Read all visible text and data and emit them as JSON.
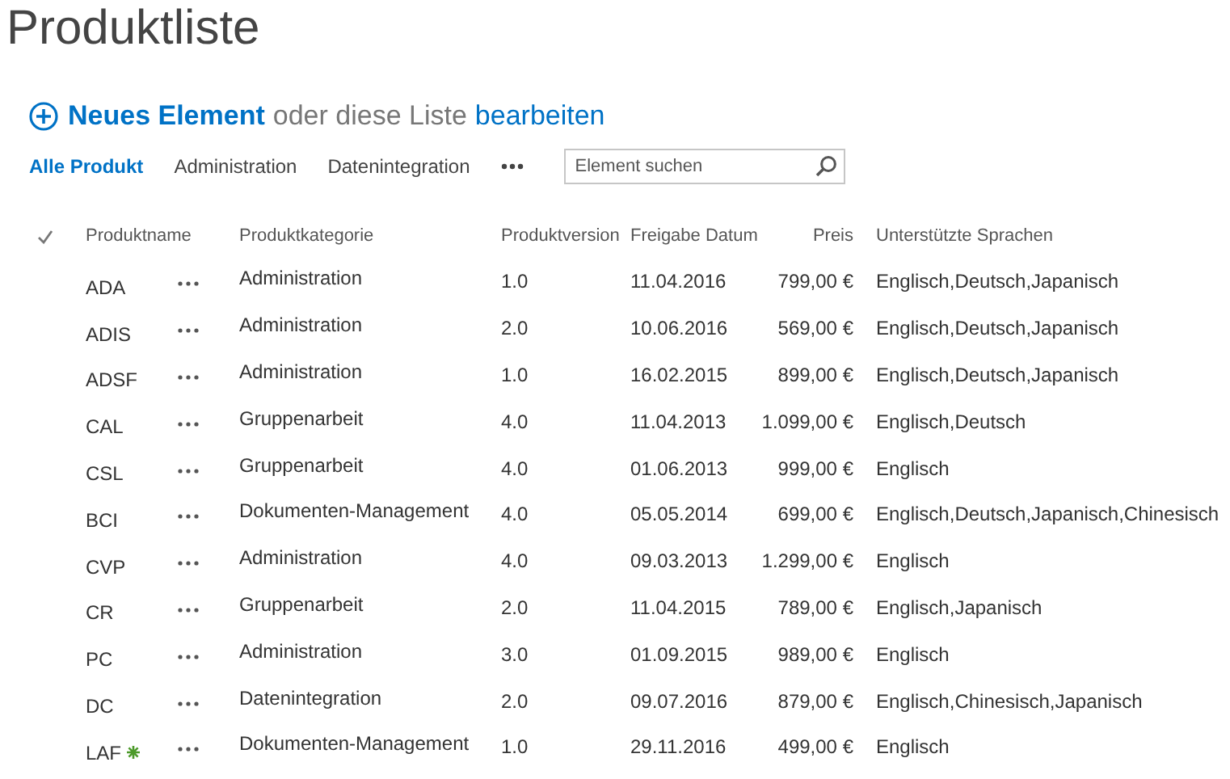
{
  "title": "Produktliste",
  "actions": {
    "new_item": "Neues Element",
    "connector": "oder diese Liste",
    "edit": "bearbeiten"
  },
  "views": [
    {
      "label": "Alle Produkt",
      "selected": true
    },
    {
      "label": "Administration",
      "selected": false
    },
    {
      "label": "Datenintegration",
      "selected": false
    }
  ],
  "search": {
    "placeholder": "Element suchen"
  },
  "table": {
    "columns": [
      "Produktname",
      "Produktkategorie",
      "Produktversion",
      "Freigabe Datum",
      "Preis",
      "Unterstützte Sprachen"
    ],
    "rows": [
      {
        "name": "ADA",
        "new": false,
        "category": "Administration",
        "version": "1.0",
        "date": "11.04.2016",
        "price": "799,00 €",
        "languages": "Englisch,Deutsch,Japanisch"
      },
      {
        "name": "ADIS",
        "new": false,
        "category": "Administration",
        "version": "2.0",
        "date": "10.06.2016",
        "price": "569,00 €",
        "languages": "Englisch,Deutsch,Japanisch"
      },
      {
        "name": "ADSF",
        "new": false,
        "category": "Administration",
        "version": "1.0",
        "date": "16.02.2015",
        "price": "899,00 €",
        "languages": "Englisch,Deutsch,Japanisch"
      },
      {
        "name": "CAL",
        "new": false,
        "category": "Gruppenarbeit",
        "version": "4.0",
        "date": "11.04.2013",
        "price": "1.099,00 €",
        "languages": "Englisch,Deutsch"
      },
      {
        "name": "CSL",
        "new": false,
        "category": "Gruppenarbeit",
        "version": "4.0",
        "date": "01.06.2013",
        "price": "999,00 €",
        "languages": "Englisch"
      },
      {
        "name": "BCI",
        "new": false,
        "category": "Dokumenten-Management",
        "version": "4.0",
        "date": "05.05.2014",
        "price": "699,00 €",
        "languages": "Englisch,Deutsch,Japanisch,Chinesisch"
      },
      {
        "name": "CVP",
        "new": false,
        "category": "Administration",
        "version": "4.0",
        "date": "09.03.2013",
        "price": "1.299,00 €",
        "languages": "Englisch"
      },
      {
        "name": "CR",
        "new": false,
        "category": "Gruppenarbeit",
        "version": "2.0",
        "date": "11.04.2015",
        "price": "789,00 €",
        "languages": "Englisch,Japanisch"
      },
      {
        "name": "PC",
        "new": false,
        "category": "Administration",
        "version": "3.0",
        "date": "01.09.2015",
        "price": "989,00 €",
        "languages": "Englisch"
      },
      {
        "name": "DC",
        "new": false,
        "category": "Datenintegration",
        "version": "2.0",
        "date": "09.07.2016",
        "price": "879,00 €",
        "languages": "Englisch,Chinesisch,Japanisch"
      },
      {
        "name": "LAF",
        "new": true,
        "category": "Dokumenten-Management",
        "version": "1.0",
        "date": "29.11.2016",
        "price": "499,00 €",
        "languages": "Englisch"
      }
    ]
  }
}
